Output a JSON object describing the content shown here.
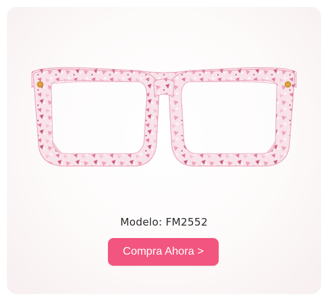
{
  "product": {
    "model_text": "Modelo: FM2552",
    "image_name": "pink-floral-transparent-eyeglasses",
    "frame_color": "#f3b8c8",
    "accent_color": "#e07896"
  },
  "cta": {
    "label": "Compra Ahora >",
    "color": "#f2557f"
  }
}
